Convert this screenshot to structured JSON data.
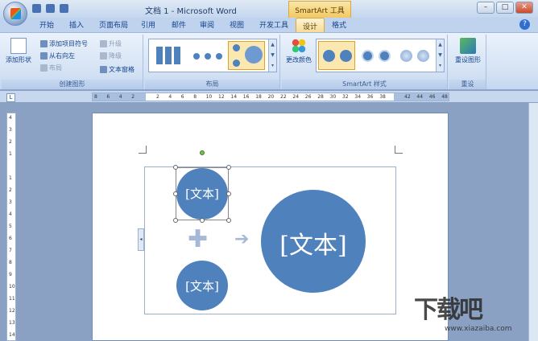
{
  "window": {
    "title": "文档 1 - Microsoft Word",
    "context_tab_title": "SmartArt 工具"
  },
  "tabs": [
    "开始",
    "插入",
    "页面布局",
    "引用",
    "邮件",
    "审阅",
    "视图",
    "开发工具",
    "设计",
    "格式"
  ],
  "active_tab": "设计",
  "ribbon": {
    "create_graphic": {
      "label": "创建图形",
      "add_shape": "添加形状",
      "add_bullet": "添加项目符号",
      "right_to_left": "从右向左",
      "layout": "布局",
      "promote": "升级",
      "demote": "降级",
      "text_pane": "文本窗格"
    },
    "layouts": {
      "label": "布局"
    },
    "styles": {
      "label": "SmartArt 样式",
      "change_colors": "更改颜色"
    },
    "reset": {
      "label": "重设",
      "reset_graphic": "重设图形"
    }
  },
  "ruler": {
    "h_ticks": [
      "8",
      "6",
      "4",
      "2",
      "",
      "2",
      "4",
      "6",
      "8",
      "10",
      "12",
      "14",
      "16",
      "18",
      "20",
      "22",
      "24",
      "26",
      "28",
      "30",
      "32",
      "34",
      "36",
      "38",
      "",
      "42",
      "44",
      "46",
      "48"
    ],
    "v_ticks": [
      "4",
      "3",
      "2",
      "1",
      "",
      "1",
      "2",
      "3",
      "4",
      "5",
      "6",
      "7",
      "8",
      "9",
      "10",
      "11",
      "12",
      "13",
      "14"
    ]
  },
  "smartart": {
    "node1": "[文本]",
    "node2": "[文本]",
    "result": "[文本]",
    "plus": "✚",
    "arrow": "➔"
  },
  "watermark": {
    "text": "下载吧",
    "url": "www.xiazaiba.com"
  },
  "colors": {
    "accent": "#4f81bd",
    "plus_arrow": "#a5b8d6"
  }
}
